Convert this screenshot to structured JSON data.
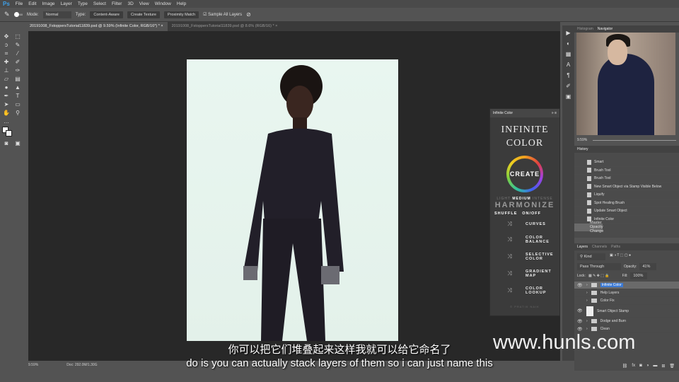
{
  "menu": [
    "File",
    "Edit",
    "Image",
    "Layer",
    "Type",
    "Select",
    "Filter",
    "3D",
    "View",
    "Window",
    "Help"
  ],
  "options": {
    "mode_label": "Mode:",
    "mode": "Normal",
    "type_label": "Type:",
    "type_buttons": [
      "Content-Aware",
      "Create Texture",
      "Proximity Match"
    ],
    "sample_all": "Sample All Layers",
    "brush_size": "60"
  },
  "tabs": [
    "20191008_FstoppersTutorial11839.psd @ 9.59% (Infinite Color, RGB/16*) *",
    "20191008_FstoppersTutorial11839.psd @ 8.6% (RGB/16) *"
  ],
  "status": {
    "zoom": "9.59%",
    "doc": "Doc: 292.0M/1.30G"
  },
  "infinite_color": {
    "panel_title": "Infinite Color",
    "title1": "INFINITE",
    "title2": "COLOR",
    "create": "CREATE",
    "light": "LIGHT",
    "medium": "MEDIUM",
    "intense": "INTENSE",
    "harmonize": "HARMONIZE",
    "shuffle": "SHUFFLE",
    "onoff": "ON/OFF",
    "items": [
      "CURVES",
      "COLOR BALANCE",
      "SELECTIVE COLOR",
      "GRADIENT MAP",
      "COLOR LOOKUP"
    ],
    "copyright": "© PRATIK NAIK"
  },
  "navigator": {
    "tabs": [
      "Histogram",
      "Navigator"
    ],
    "zoom": "9.59%"
  },
  "history": {
    "title": "History",
    "items": [
      "Smart",
      "Brush Tool",
      "Brush Tool",
      "New Smart Object via Stamp Visible Below",
      "Liquify",
      "Spot Healing Brush",
      "Update Smart Object",
      "Infinite Color",
      "Master Opacity Change"
    ]
  },
  "layers": {
    "tabs": [
      "Layers",
      "Channels",
      "Paths"
    ],
    "kind": "Kind",
    "blend": "Pass Through",
    "opacity_label": "Opacity:",
    "opacity": "41%",
    "lock_label": "Lock:",
    "fill_label": "Fill:",
    "fill": "100%",
    "items": [
      "Infinite Color",
      "Help Layers",
      "Color Fix",
      "Smart Object Stamp",
      "Dodge and Burn",
      "Clean"
    ]
  },
  "subtitle": {
    "zh": "你可以把它们堆叠起来这样我就可以给它命名了",
    "en": "do is you can actually stack layers of them so i can just name this"
  },
  "watermark": "www.hunls.com"
}
